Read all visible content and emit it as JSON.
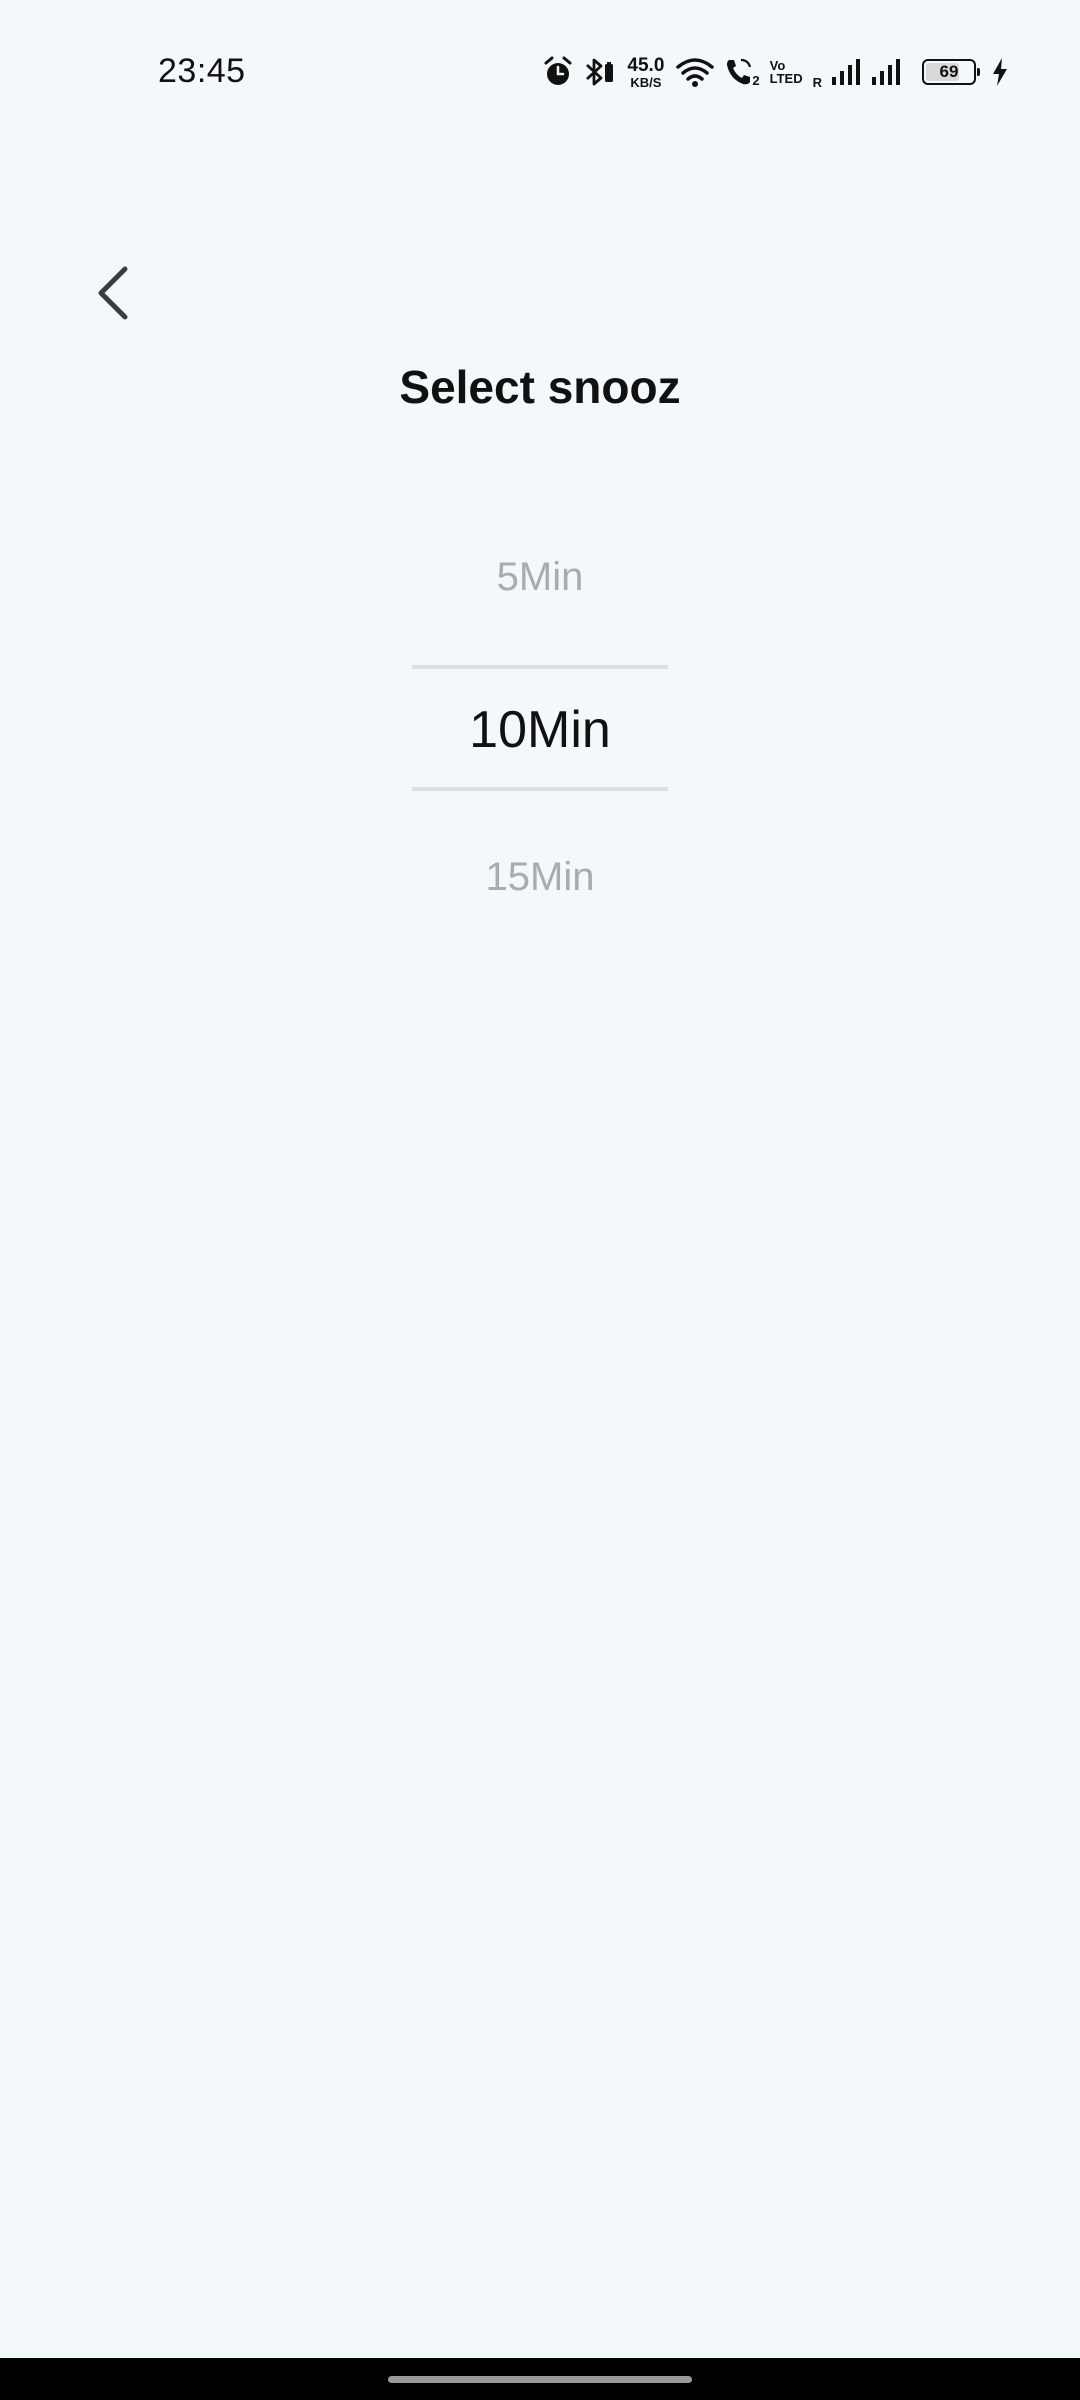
{
  "status_bar": {
    "time": "23:45",
    "net_speed_value": "45.0",
    "net_speed_unit": "KB/S",
    "volte_top": "Vo",
    "volte_bottom": "LTE",
    "volte_sim": "D",
    "call_sim": "2",
    "roaming": "R",
    "battery_level": "69",
    "icons": [
      "alarm-icon",
      "bluetooth-icon",
      "wifi-icon",
      "wifi-calling-icon",
      "volte-icon",
      "signal-icon",
      "signal-icon",
      "battery-icon",
      "charging-icon"
    ]
  },
  "header": {
    "back_icon": "chevron-left-icon",
    "title": "Select snooz"
  },
  "picker": {
    "options": [
      "5Min",
      "10Min",
      "15Min"
    ],
    "selected": "10Min"
  },
  "colors": {
    "background": "#f3f8fb",
    "text_primary": "#111111",
    "text_muted": "#a9acae",
    "divider": "#dcdfe1"
  }
}
